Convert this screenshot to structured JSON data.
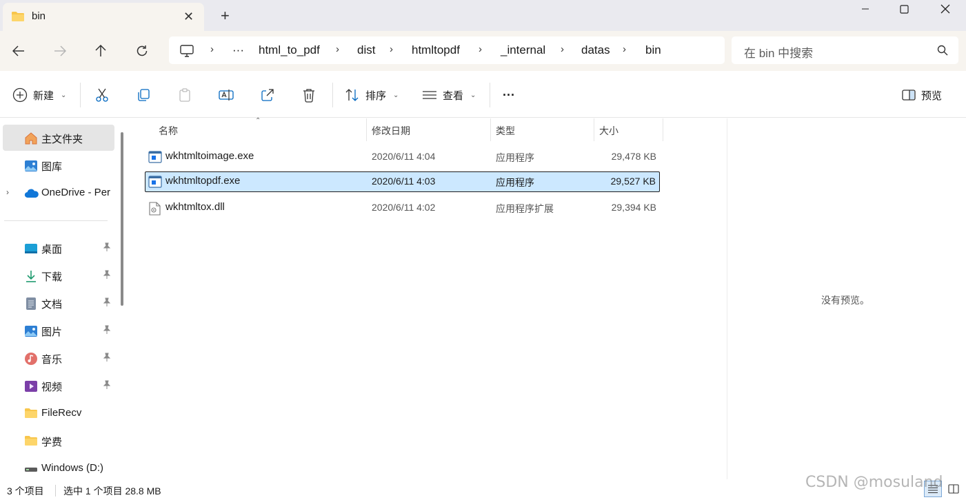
{
  "window": {
    "tab_title": "bin",
    "tab_folder_icon": "folder-icon",
    "new_tab_glyph": "+",
    "close_glyph": "✕"
  },
  "address": {
    "separator": "›",
    "overflow": "···",
    "breadcrumbs": [
      "html_to_pdf",
      "dist",
      "htmltopdf",
      "_internal",
      "datas",
      "bin"
    ]
  },
  "search": {
    "placeholder": "在 bin 中搜索"
  },
  "toolbar": {
    "new_label": "新建",
    "sort_label": "排序",
    "view_label": "查看",
    "more_label": "···",
    "preview_label": "预览"
  },
  "sidebar": {
    "items": [
      {
        "label": "主文件夹",
        "icon": "home-icon",
        "selected": true,
        "pinned": false
      },
      {
        "label": "图库",
        "icon": "gallery-icon",
        "selected": false,
        "pinned": false
      },
      {
        "label": "OneDrive - Per",
        "icon": "onedrive-icon",
        "selected": false,
        "pinned": false,
        "expandable": true
      },
      {
        "label": "桌面",
        "icon": "desktop-icon",
        "selected": false,
        "pinned": true
      },
      {
        "label": "下载",
        "icon": "download-icon",
        "selected": false,
        "pinned": true
      },
      {
        "label": "文档",
        "icon": "document-icon",
        "selected": false,
        "pinned": true
      },
      {
        "label": "图片",
        "icon": "pictures-icon",
        "selected": false,
        "pinned": true
      },
      {
        "label": "音乐",
        "icon": "music-icon",
        "selected": false,
        "pinned": true
      },
      {
        "label": "视频",
        "icon": "video-icon",
        "selected": false,
        "pinned": true
      },
      {
        "label": "FileRecv",
        "icon": "folder-icon",
        "selected": false,
        "pinned": false
      },
      {
        "label": "学费",
        "icon": "folder-icon",
        "selected": false,
        "pinned": false
      },
      {
        "label": "Windows (D:)",
        "icon": "drive-icon",
        "selected": false,
        "pinned": false
      }
    ]
  },
  "columns": {
    "name": "名称",
    "modified": "修改日期",
    "type": "类型",
    "size": "大小"
  },
  "files": [
    {
      "name": "wkhtmltoimage.exe",
      "modified": "2020/6/11 4:04",
      "type": "应用程序",
      "size": "29,478 KB",
      "icon": "exe-icon",
      "selected": false
    },
    {
      "name": "wkhtmltopdf.exe",
      "modified": "2020/6/11 4:03",
      "type": "应用程序",
      "size": "29,527 KB",
      "icon": "exe-icon",
      "selected": true
    },
    {
      "name": "wkhtmltox.dll",
      "modified": "2020/6/11 4:02",
      "type": "应用程序扩展",
      "size": "29,394 KB",
      "icon": "dll-icon",
      "selected": false
    }
  ],
  "preview": {
    "empty_text": "没有预览。"
  },
  "status": {
    "item_count": "3 个项目",
    "selection": "选中 1 个项目 28.8 MB"
  },
  "watermark": "CSDN @mosuland",
  "colors": {
    "accent": "#0067c0",
    "selection_bg": "#cce8ff",
    "titlebar_bg": "#eaeaef",
    "address_row_bg": "#f7f4ef",
    "folder": "#f8c64c"
  }
}
